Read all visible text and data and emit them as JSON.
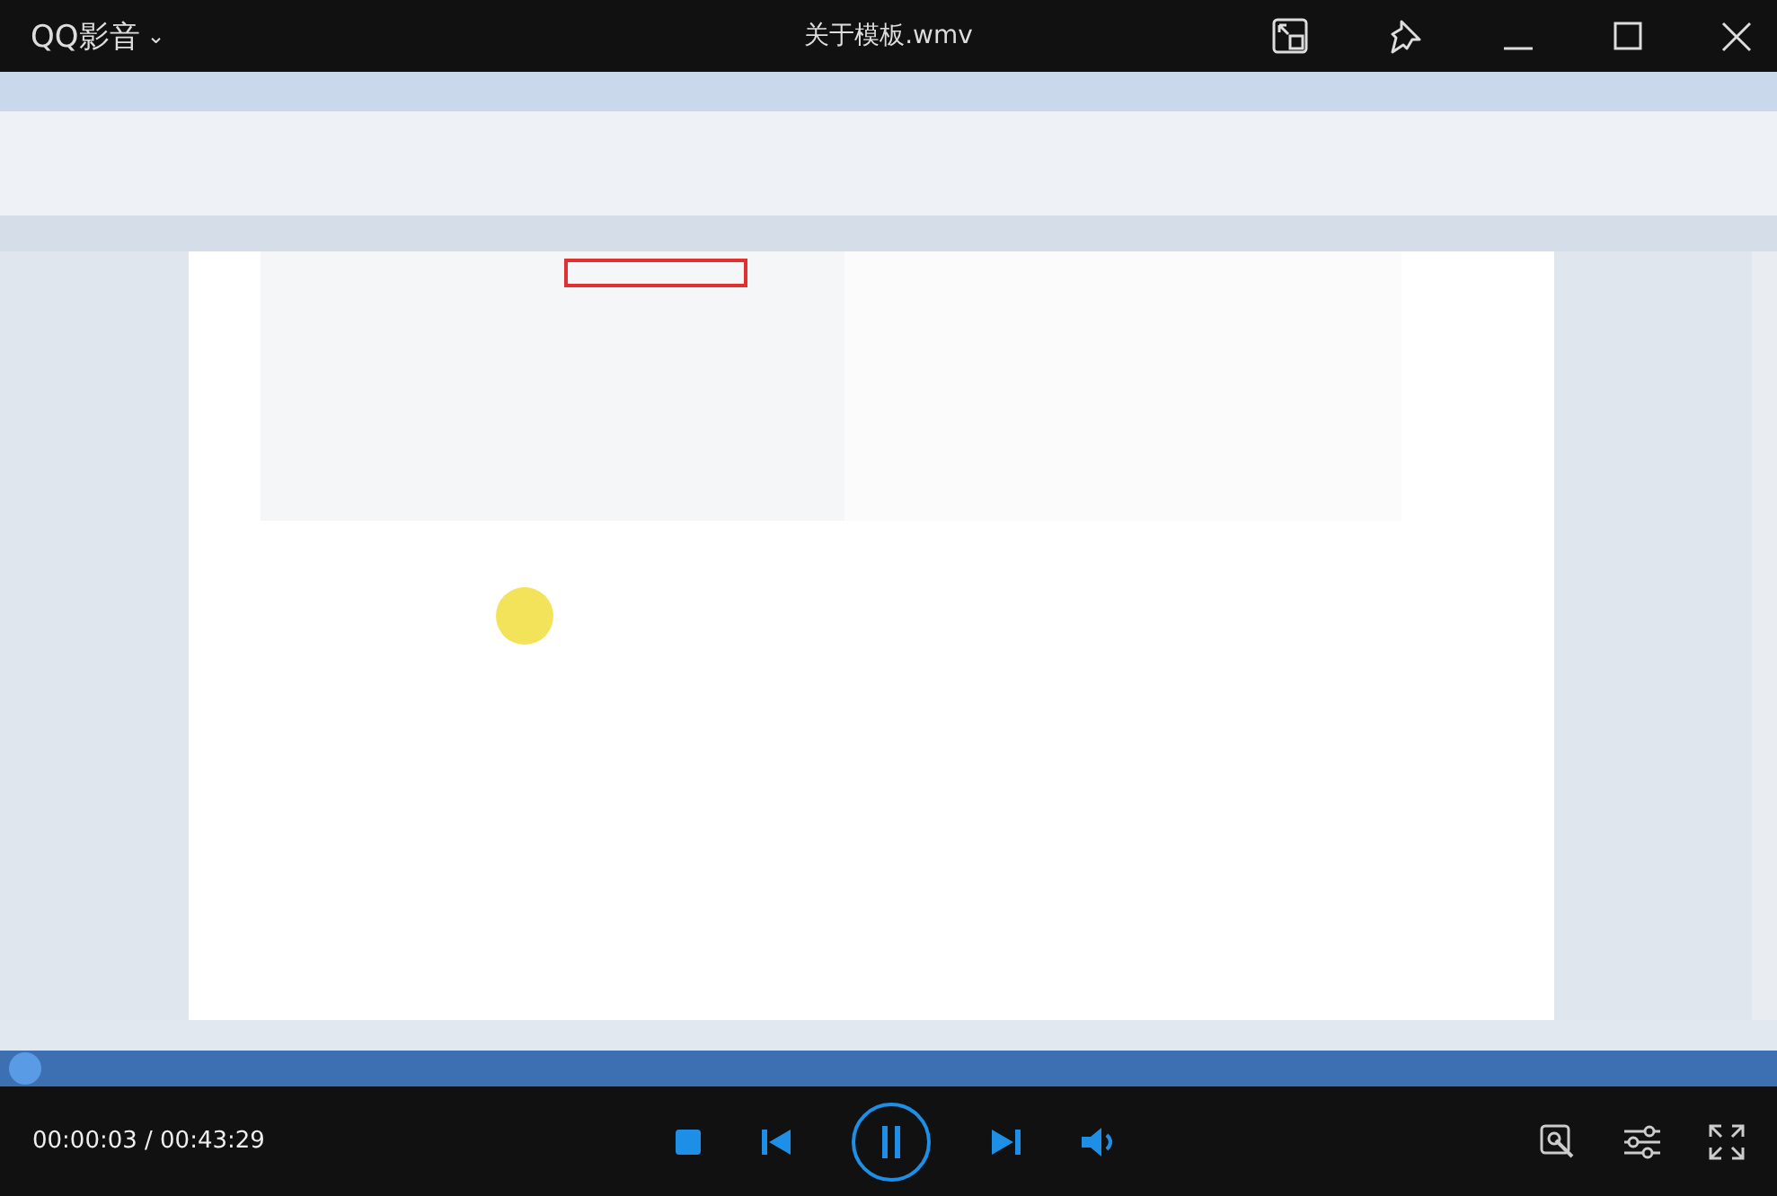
{
  "app": {
    "title": "QQ影音",
    "menu_caret": "⌄"
  },
  "video": {
    "file_name": "关于模板.wmv",
    "kind": "picture"
  },
  "playback": {
    "time": "00:00:03 / 00:43:29",
    "playing": true
  }
}
